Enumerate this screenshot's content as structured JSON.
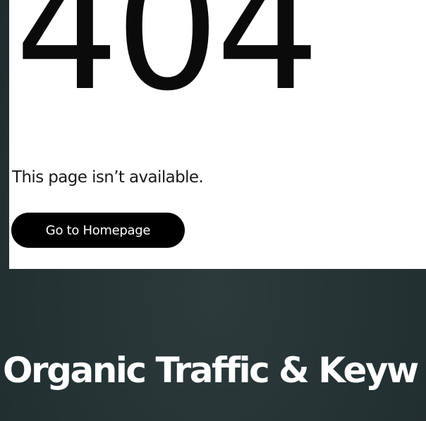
{
  "error_page": {
    "code": "404",
    "message": "This page isn’t available.",
    "button_label": "Go to Homepage"
  },
  "section": {
    "heading": "Organic Traffic & Keyw"
  },
  "colors": {
    "background": "#243234",
    "card": "#ffffff",
    "button": "#000000",
    "text_dark": "#0b0b0b",
    "text_light": "#ffffff"
  }
}
